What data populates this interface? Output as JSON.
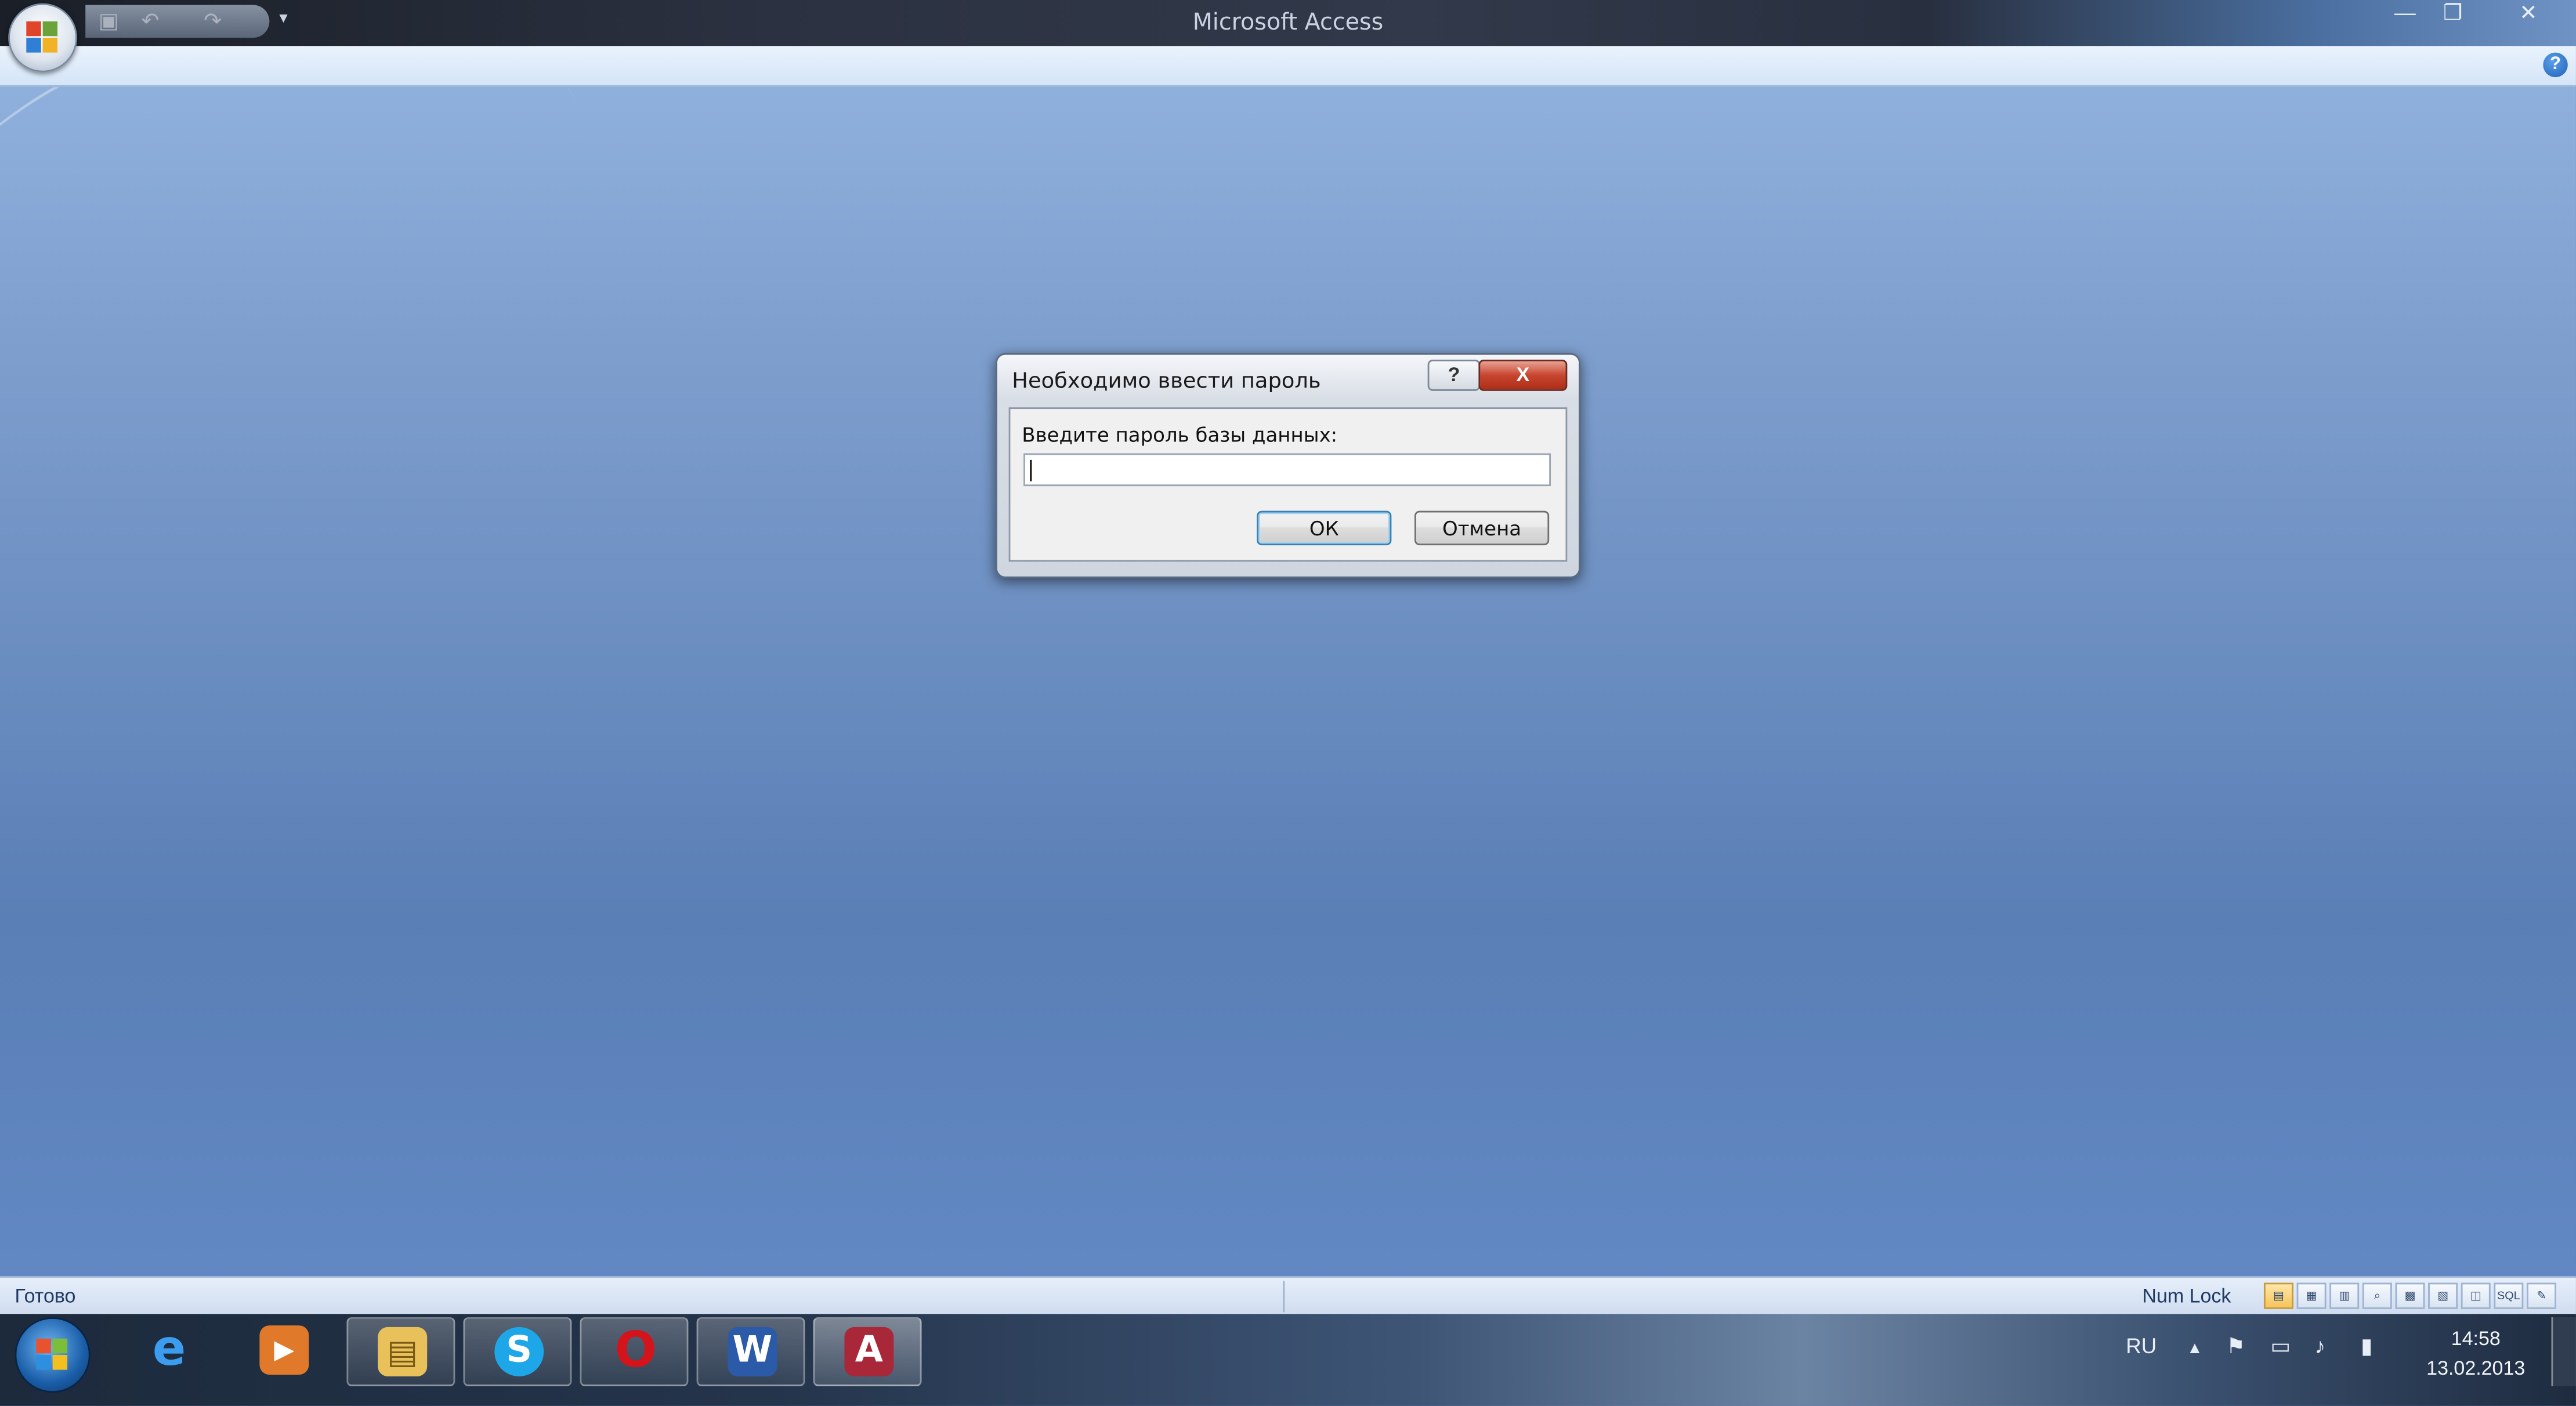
{
  "window": {
    "title": "Microsoft Access",
    "quick_access": [
      "save-icon",
      "undo-icon",
      "redo-icon"
    ],
    "controls": {
      "minimize": "—",
      "restore": "❐",
      "close": "✕"
    },
    "help_glyph": "?"
  },
  "dialog": {
    "title": "Необходимо ввести пароль",
    "help_glyph": "?",
    "close_glyph": "X",
    "prompt": "Введите пароль базы данных:",
    "password_value": "",
    "ok_label": "ОК",
    "cancel_label": "Отмена"
  },
  "statusbar": {
    "ready": "Готово",
    "num_lock": "Num Lock",
    "view_buttons": [
      "form-view",
      "datasheet-view",
      "layout-view",
      "print-preview",
      "pivot-table",
      "pivot-chart",
      "design-view",
      "sql-view",
      "design-view-alt"
    ]
  },
  "taskbar": {
    "apps": [
      {
        "name": "internet-explorer",
        "glyph": "e",
        "color": "#2f8ee0"
      },
      {
        "name": "media-player",
        "glyph": "▶",
        "color": "#e07a2a"
      },
      {
        "name": "windows-explorer",
        "glyph": "▤",
        "color": "#e8c15a"
      },
      {
        "name": "skype",
        "glyph": "S",
        "color": "#1ea7e8"
      },
      {
        "name": "opera",
        "glyph": "O",
        "color": "#d4131b"
      },
      {
        "name": "word",
        "glyph": "W",
        "color": "#2b5aa8"
      },
      {
        "name": "access",
        "glyph": "A",
        "color": "#a8283a"
      }
    ],
    "language": "RU",
    "time": "14:58",
    "date": "13.02.2013"
  }
}
